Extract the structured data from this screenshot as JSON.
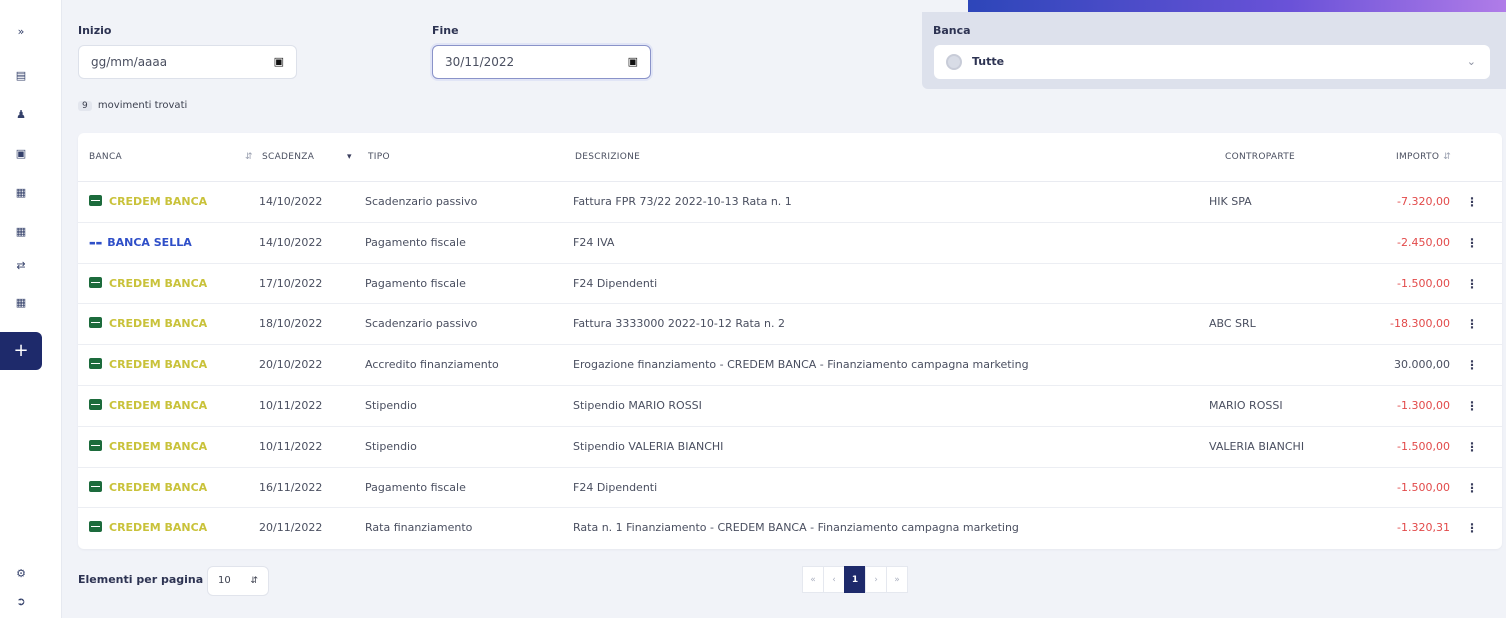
{
  "filters": {
    "start": {
      "label": "Inizio",
      "value": "gg/mm/aaaa"
    },
    "end": {
      "label": "Fine",
      "value": "30/11/2022"
    },
    "bank": {
      "label": "Banca",
      "value": "Tutte"
    }
  },
  "results": {
    "count": "9",
    "text": "movimenti trovati"
  },
  "table": {
    "headers": {
      "bank": "BANCA",
      "due": "SCADENZA",
      "type": "TIPO",
      "description": "DESCRIZIONE",
      "counterpart": "CONTROPARTE",
      "amount": "IMPORTO"
    },
    "rows": [
      {
        "bank": "CREDEM BANCA",
        "bank_id": "credem",
        "due": "14/10/2022",
        "type": "Scadenzario passivo",
        "description": "Fattura FPR 73/22 2022-10-13 Rata n. 1",
        "counterpart": "HIK SPA",
        "amount": "-7.320,00"
      },
      {
        "bank": "BANCA SELLA",
        "bank_id": "sella",
        "due": "14/10/2022",
        "type": "Pagamento fiscale",
        "description": "F24 IVA",
        "counterpart": "",
        "amount": "-2.450,00"
      },
      {
        "bank": "CREDEM BANCA",
        "bank_id": "credem",
        "due": "17/10/2022",
        "type": "Pagamento fiscale",
        "description": "F24 Dipendenti",
        "counterpart": "",
        "amount": "-1.500,00"
      },
      {
        "bank": "CREDEM BANCA",
        "bank_id": "credem",
        "due": "18/10/2022",
        "type": "Scadenzario passivo",
        "description": "Fattura 3333000 2022-10-12 Rata n. 2",
        "counterpart": "ABC SRL",
        "amount": "-18.300,00"
      },
      {
        "bank": "CREDEM BANCA",
        "bank_id": "credem",
        "due": "20/10/2022",
        "type": "Accredito finanziamento",
        "description": "Erogazione finanziamento - CREDEM BANCA - Finanziamento campagna marketing",
        "counterpart": "",
        "amount": "30.000,00"
      },
      {
        "bank": "CREDEM BANCA",
        "bank_id": "credem",
        "due": "10/11/2022",
        "type": "Stipendio",
        "description": "Stipendio MARIO ROSSI",
        "counterpart": "MARIO ROSSI",
        "amount": "-1.300,00"
      },
      {
        "bank": "CREDEM BANCA",
        "bank_id": "credem",
        "due": "10/11/2022",
        "type": "Stipendio",
        "description": "Stipendio VALERIA BIANCHI",
        "counterpart": "VALERIA BIANCHI",
        "amount": "-1.500,00"
      },
      {
        "bank": "CREDEM BANCA",
        "bank_id": "credem",
        "due": "16/11/2022",
        "type": "Pagamento fiscale",
        "description": "F24 Dipendenti",
        "counterpart": "",
        "amount": "-1.500,00"
      },
      {
        "bank": "CREDEM BANCA",
        "bank_id": "credem",
        "due": "20/11/2022",
        "type": "Rata finanziamento",
        "description": "Rata n. 1 Finanziamento - CREDEM BANCA - Finanziamento campagna marketing",
        "counterpart": "",
        "amount": "-1.320,31"
      }
    ]
  },
  "footer": {
    "per_page_label": "Elementi per pagina",
    "per_page_value": "10",
    "pagination": {
      "first": "«",
      "prev": "‹",
      "current": "1",
      "next": "›",
      "last": "»"
    }
  },
  "colors": {
    "primary": "#1e2a6b",
    "credem": "#c9c23a",
    "sella": "#2f4fc8",
    "negative": "#e24a4a"
  }
}
